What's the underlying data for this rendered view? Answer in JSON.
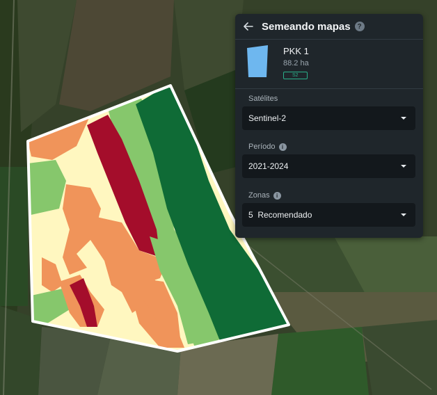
{
  "panel": {
    "title": "Semeando mapas",
    "field": {
      "name": "PKK 1",
      "area": "88.2 ha",
      "badge": "S2"
    },
    "satellites": {
      "label": "Satélites",
      "value": "Sentinel-2"
    },
    "period": {
      "label": "Período",
      "value": "2021-2024"
    },
    "zones": {
      "label": "Zonas",
      "value": "5  Recomendado"
    }
  },
  "icons": {
    "back": "arrow-left-icon",
    "help": "question-circle-icon",
    "info": "info-circle-icon",
    "dropdown": "caret-down-icon"
  },
  "colors": {
    "panel_bg": "#1f262b",
    "dropdown_bg": "#13181c",
    "badge": "#2ab08a",
    "field_thumb": "#6eb7ef",
    "zone_1": "#0f6b36",
    "zone_2": "#86c76c",
    "zone_3": "#fff7c0",
    "zone_4": "#f0945a",
    "zone_5": "#a40d2b"
  }
}
